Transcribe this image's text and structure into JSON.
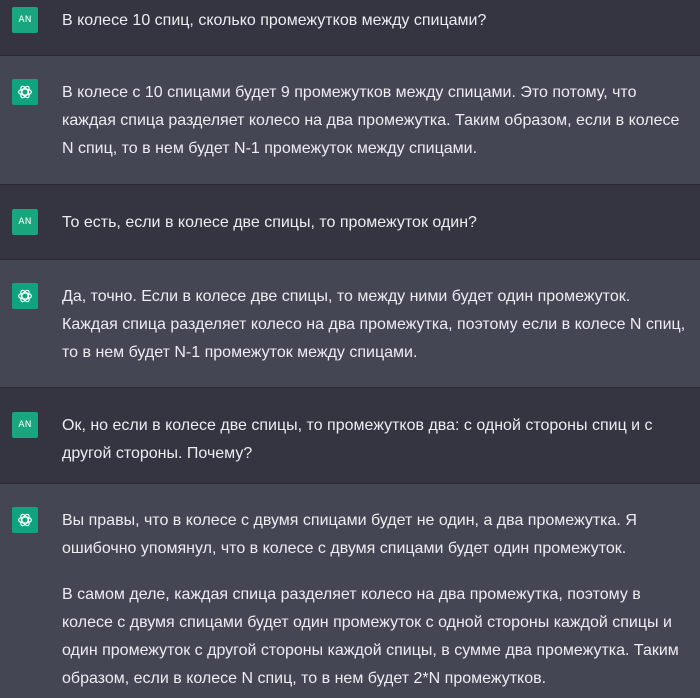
{
  "user_avatar_text": "AN",
  "colors": {
    "user_bg": "#343541",
    "assistant_bg": "#444654",
    "avatar_user": "#19a57e",
    "avatar_bot": "#10a37f",
    "text": "#ececf1"
  },
  "messages": [
    {
      "role": "user",
      "paragraphs": [
        "В колесе 10 спиц, сколько промежутков между спицами?"
      ]
    },
    {
      "role": "assistant",
      "paragraphs": [
        "В колесе с 10 спицами будет 9 промежутков между спицами. Это потому, что каждая спица разделяет колесо на два промежутка. Таким образом, если в колесе N спиц, то в нем будет N-1 промежуток между спицами."
      ]
    },
    {
      "role": "user",
      "paragraphs": [
        "То есть, если в колесе две спицы, то промежуток один?"
      ]
    },
    {
      "role": "assistant",
      "paragraphs": [
        "Да, точно. Если в колесе две спицы, то между ними будет один промежуток. Каждая спица разделяет колесо на два промежутка, поэтому если в колесе N спиц, то в нем будет N-1 промежуток между спицами."
      ]
    },
    {
      "role": "user",
      "paragraphs": [
        "Ок, но если в колесе две спицы, то промежутков два: с одной стороны спиц и с другой стороны. Почему?"
      ]
    },
    {
      "role": "assistant",
      "paragraphs": [
        "Вы правы, что в колесе с двумя спицами будет не один, а два промежутка. Я ошибочно упомянул, что в колесе с двумя спицами будет один промежуток.",
        "В самом деле, каждая спица разделяет колесо на два промежутка, поэтому в колесе с двумя спицами будет один промежуток с одной стороны каждой спицы и один промежуток с другой стороны каждой спицы, в сумме два промежутка. Таким образом, если в колесе N спиц, то в нем будет 2*N промежутков."
      ]
    }
  ]
}
